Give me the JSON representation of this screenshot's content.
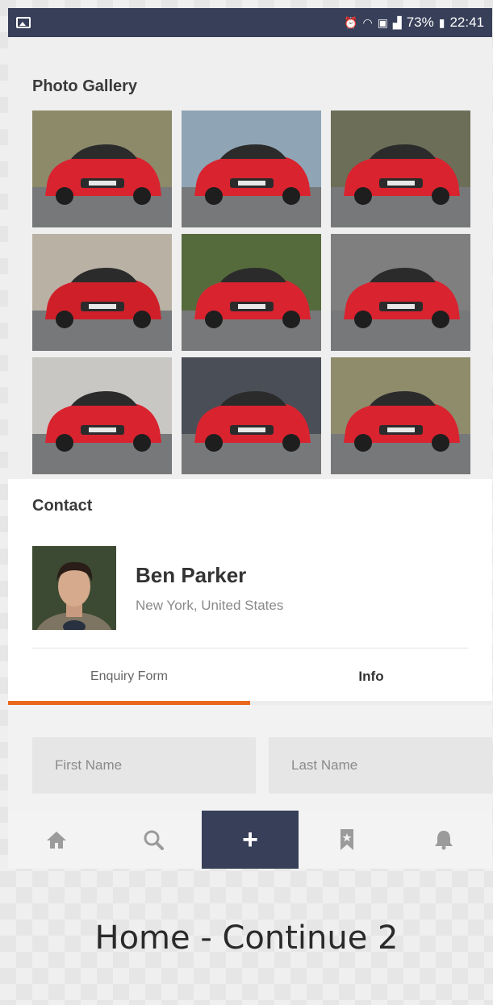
{
  "status_bar": {
    "battery": "73%",
    "time": "22:41",
    "icons": [
      "image-icon",
      "alarm-icon",
      "wifi-icon",
      "sim-icon",
      "signal-icon",
      "battery-icon"
    ]
  },
  "gallery": {
    "title": "Photo Gallery",
    "photos": [
      {
        "name": "red-audi-r8-front",
        "bg": "#8d8a6a",
        "car": "#d9232f"
      },
      {
        "name": "red-audi-road-distance",
        "bg": "#8fa5b6",
        "car": "#d9232f"
      },
      {
        "name": "red-audi-r8-side",
        "bg": "#6c6e58",
        "car": "#d9232f"
      },
      {
        "name": "red-audi-r8-misty",
        "bg": "#b9b1a4",
        "car": "#cf2029"
      },
      {
        "name": "red-audi-convertible",
        "bg": "#566b3c",
        "car": "#d9232f"
      },
      {
        "name": "red-audi-r8-countryside",
        "bg": "#7f7f7f",
        "car": "#d9232f"
      },
      {
        "name": "red-audi-top-view",
        "bg": "#c9c7c3",
        "car": "#d9232f"
      },
      {
        "name": "red-audi-r8-rear",
        "bg": "#4a4e57",
        "car": "#d9232f"
      },
      {
        "name": "red-audi-r8-front-2",
        "bg": "#8f8c6c",
        "car": "#d9232f"
      }
    ]
  },
  "contact": {
    "title": "Contact",
    "name": "Ben Parker",
    "location": "New York, United States",
    "tabs": [
      {
        "label": "Enquiry Form"
      },
      {
        "label": "Info"
      }
    ],
    "form": {
      "first_name_placeholder": "First Name",
      "last_name_placeholder": "Last Name"
    }
  },
  "bottom_nav": {
    "plus_label": "+"
  },
  "caption": "Home - Continue 2",
  "colors": {
    "accent": "#e8691e",
    "navy": "#373f59"
  }
}
